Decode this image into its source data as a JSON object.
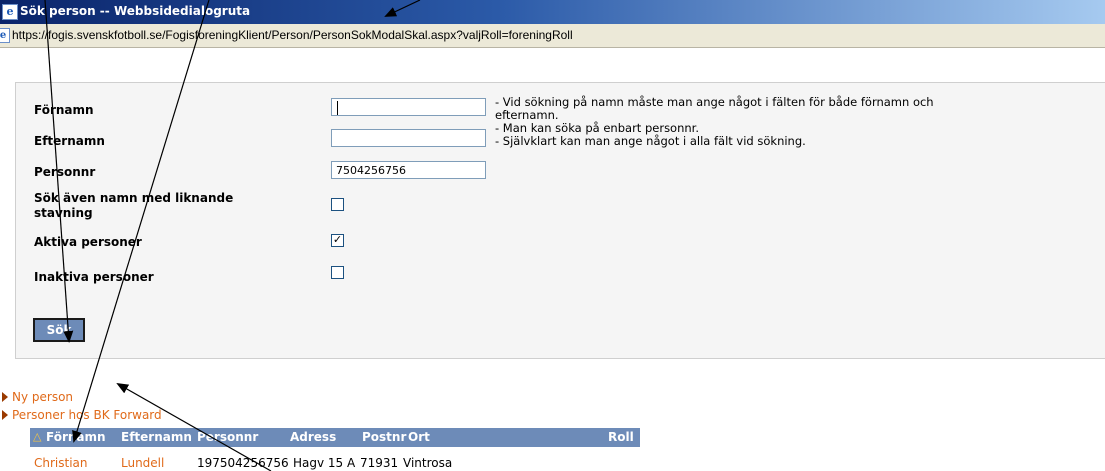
{
  "window": {
    "title": "Sök person -- Webbsidedialogruta",
    "url": "https://fogis.svenskfotboll.se/FogisforeningKlient/Person/PersonSokModalSkal.aspx?valjRoll=foreningRoll"
  },
  "form": {
    "fornamn_label": "Förnamn",
    "efternamn_label": "Efternamn",
    "personnr_label": "Personnr",
    "personnr_value": "7504256756",
    "liknande_label_line1": "Sök även namn med liknande",
    "liknande_label_line2": "stavning",
    "aktiva_label": "Aktiva personer",
    "inaktiva_label": "Inaktiva personer",
    "liknande_checked": false,
    "aktiva_checked": true,
    "inaktiva_checked": false,
    "help_text": "- Vid sökning på namn måste man ange något i fälten för både förnamn och\nefternamn.\n- Man kan söka på enbart personnr.\n- Självklart kan man ange något i alla fält vid sökning.",
    "search_button": "Sök"
  },
  "links": {
    "ny_person": "Ny person",
    "personer_hos": "Personer hos BK Forward"
  },
  "table": {
    "sort_indicator": "△",
    "columns": [
      "Förnamn",
      "Efternamn",
      "Personnr",
      "Adress",
      "Postnr",
      "Ort",
      "Roll"
    ],
    "rows": [
      [
        "Christian",
        "Lundell",
        "197504256756",
        "Hagv 15 A",
        "71931",
        "Vintrosa",
        ""
      ]
    ]
  },
  "colors": {
    "header_bg": "#6d8bb8",
    "link": "#e06a1a",
    "titlebar": "#0a246a"
  }
}
